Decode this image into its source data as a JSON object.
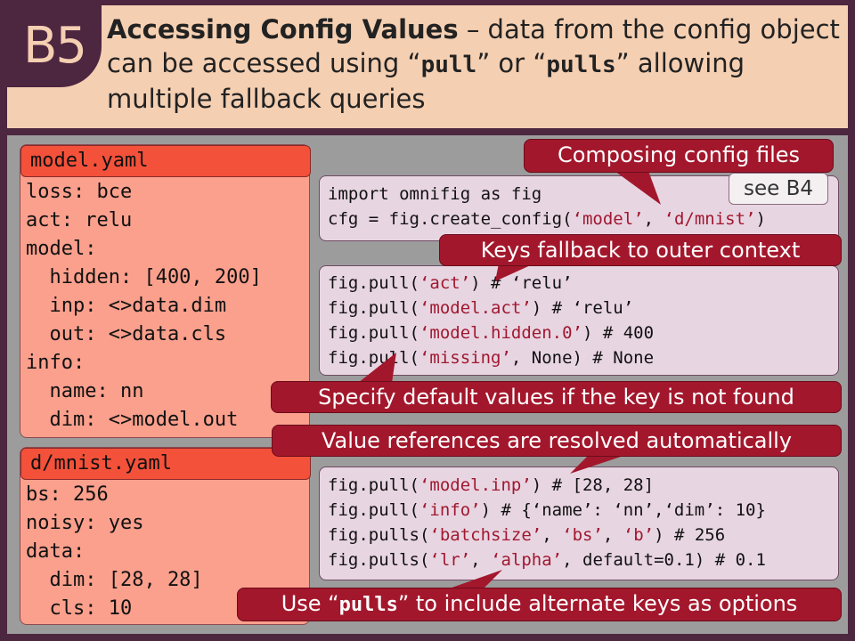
{
  "header": {
    "badge": "B5",
    "title": "Accessing Config Values",
    "desc_1": " – data from the config object can be accessed using ",
    "pull": "pull",
    "desc_2": " or ",
    "pulls": "pulls",
    "desc_3": " allowing multiple fallback queries"
  },
  "model_yaml": {
    "title": "model.yaml",
    "lines": [
      "loss: bce",
      "act: relu",
      "model:",
      "  hidden: [400, 200]",
      "  inp: <>data.dim",
      "  out: <>data.cls",
      "info:",
      "  name: nn",
      "  dim: <>model.out"
    ]
  },
  "mnist_yaml": {
    "title": "d/mnist.yaml",
    "lines": [
      "bs: 256",
      "noisy: yes",
      "data:",
      "  dim: [28, 28]",
      "  cls: 10"
    ]
  },
  "code_compose": {
    "line1": "import omnifig as fig",
    "l2_a": "cfg = fig.create_config(",
    "l2_s1": "‘model’",
    "l2_b": ", ",
    "l2_s2": "‘d/mnist’",
    "l2_c": ")"
  },
  "code_pull": {
    "l1_a": "fig.pull(",
    "l1_s": "‘act’",
    "l1_b": ") # ‘relu’",
    "l2_a": "fig.pull(",
    "l2_s": "‘model.act’",
    "l2_b": ") # ‘relu’",
    "l3_a": "fig.pull(",
    "l3_s": "‘model.hidden.0’",
    "l3_b": ") # 400",
    "l4_a": "fig.pull(",
    "l4_s": "‘missing’",
    "l4_b": ", None) # None"
  },
  "code_refs": {
    "l1_a": "fig.pull(",
    "l1_s": "‘model.inp’",
    "l1_b": ") # [28, 28]",
    "l2_a": "fig.pull(",
    "l2_s": "‘info’",
    "l2_b": ") # {‘name’: ‘nn’,‘dim’: 10}",
    "l3_a": "fig.pulls(",
    "l3_s1": "‘batchsize’",
    "l3_b": ", ",
    "l3_s2": "‘bs’",
    "l3_c": ", ",
    "l3_s3": "‘b’",
    "l3_d": ") # 256",
    "l4_a": "fig.pulls(",
    "l4_s1": "‘lr’",
    "l4_b": ", ",
    "l4_s2": "‘alpha’",
    "l4_c": ", default=0.1) # 0.1"
  },
  "callouts": {
    "composing": "Composing config files",
    "see": "see B4",
    "fallback": "Keys fallback to outer context",
    "defaults": "Specify default values if the key is not found",
    "references": "Value references are resolved automatically",
    "pulls_pre": "Use “",
    "pulls_code": "pulls",
    "pulls_post": "” to include alternate keys as options"
  },
  "colors": {
    "background": "#4d2640",
    "header": "#f4cfb2",
    "yaml_box": "#fba08d",
    "yaml_title": "#f4513a",
    "code_box": "#e8d5e2",
    "callout": "#a3172c",
    "string": "#a0182f"
  }
}
